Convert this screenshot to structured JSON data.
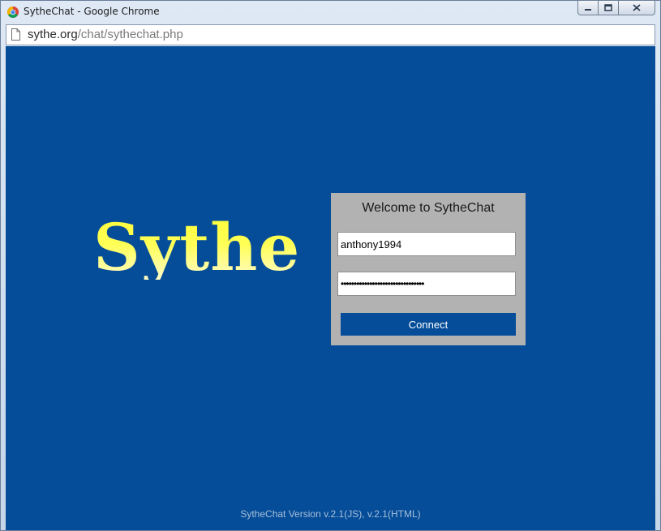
{
  "window": {
    "title": "SytheChat - Google Chrome",
    "controls": [
      "minimize",
      "maximize",
      "close"
    ]
  },
  "address_bar": {
    "domain": "sythe.org",
    "path": "/chat/sythechat.php"
  },
  "page": {
    "logo_text": "Sythe",
    "login": {
      "welcome": "Welcome to SytheChat",
      "username_value": "anthony1994",
      "password_value": "••••••••••••••••••••••••••••••••",
      "connect_label": "Connect"
    },
    "version_text": "SytheChat Version v.2.1(JS), v.2.1(HTML)"
  },
  "colors": {
    "page_background": "#054d99",
    "panel_background": "#b2b2b2",
    "button_background": "#054d99",
    "logo_gradient_top": "#ffff3a",
    "logo_gradient_bottom": "#fffbc8"
  }
}
